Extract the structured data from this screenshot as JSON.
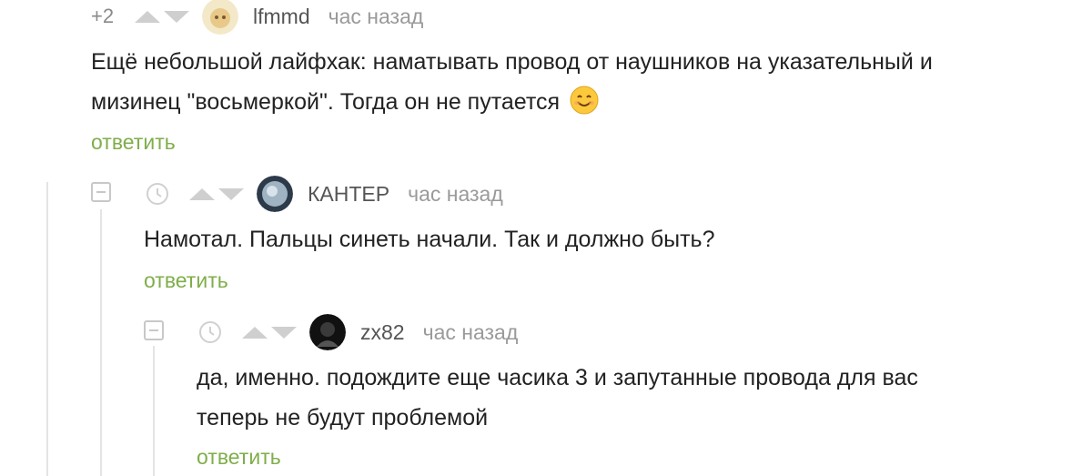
{
  "comments": [
    {
      "rating": "+2",
      "username": "lfmmd",
      "time": "час назад",
      "text_line1": "Ещё небольшой лайфхак: наматывать провод от наушников на указательный и",
      "text_line2": "мизинец \"восьмеркой\". Тогда он не путается",
      "emoji": "smiling-face-emoji",
      "reply_label": "ответить"
    },
    {
      "username": "КАНТЕР",
      "time": "час назад",
      "text_line1": "Намотал. Пальцы синеть начали. Так и должно быть?",
      "reply_label": "ответить"
    },
    {
      "username": "zx82",
      "time": "час назад",
      "text_line1": "да, именно. подождите еще часика 3 и запутанные провода для вас",
      "text_line2": "теперь не будут проблемой",
      "reply_label": "ответить"
    }
  ],
  "colors": {
    "reply": "#7fae4a",
    "muted": "#9a9a9a",
    "arrows": "#cfcfcf"
  }
}
